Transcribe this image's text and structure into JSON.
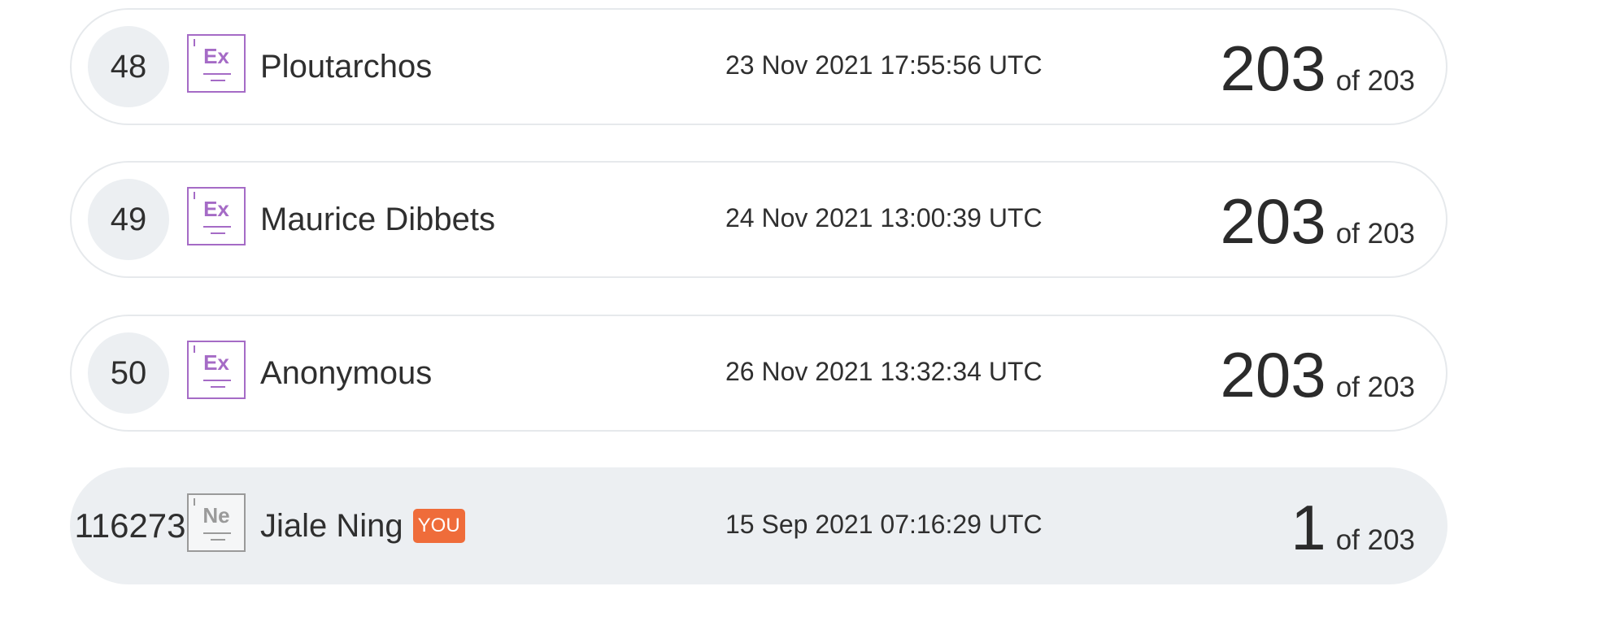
{
  "leaderboard": {
    "rows": [
      {
        "rank": "48",
        "level_symbol": "Ex",
        "name": "Ploutarchos",
        "date": "23 Nov 2021 17:55:56 UTC",
        "score": "203",
        "total": "of 203"
      },
      {
        "rank": "49",
        "level_symbol": "Ex",
        "name": "Maurice Dibbets",
        "date": "24 Nov 2021 13:00:39 UTC",
        "score": "203",
        "total": "of 203"
      },
      {
        "rank": "50",
        "level_symbol": "Ex",
        "name": "Anonymous",
        "date": "26 Nov 2021 13:32:34 UTC",
        "score": "203",
        "total": "of 203"
      },
      {
        "rank": "116273",
        "level_symbol": "Ne",
        "name": "Jiale Ning",
        "you_label": "YOU",
        "date": "15 Sep 2021 07:16:29 UTC",
        "score": "1",
        "total": "of 203"
      }
    ]
  },
  "colors": {
    "expert_badge": "#a56bc6",
    "novice_badge": "#9a9a9a",
    "you_tag": "#ef6c3a",
    "row_highlight": "#eceff2"
  }
}
